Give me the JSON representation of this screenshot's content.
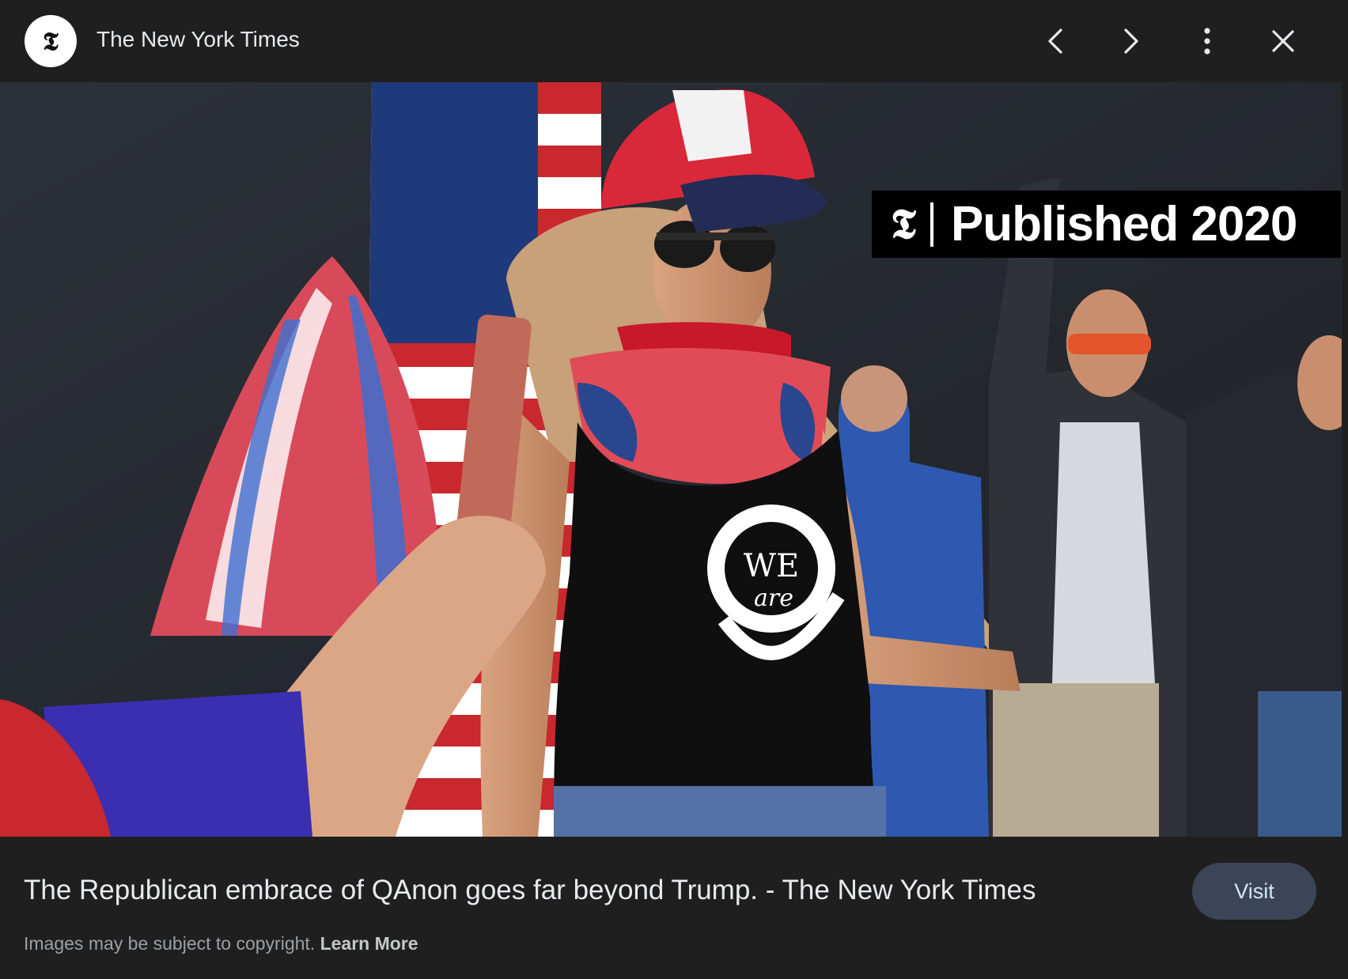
{
  "header": {
    "source_name": "The New York Times",
    "logo_glyph": "𝕿",
    "buttons": {
      "previous_icon": "chevron-left-icon",
      "next_icon": "chevron-right-icon",
      "more_icon": "more-vert-icon",
      "close_icon": "close-icon"
    }
  },
  "image": {
    "badge": {
      "logo_glyph": "𝕿",
      "text": "Published 2020"
    },
    "shirt_text_top": "WE",
    "shirt_text_bottom": "are",
    "lens_icon": "lens-search-icon"
  },
  "footer": {
    "title": "The Republican embrace of QAnon goes far beyond Trump. - The New York Times",
    "visit_label": "Visit",
    "copyright_text": "Images may be subject to copyright.",
    "learn_more_label": "Learn More"
  },
  "colors": {
    "background": "#1f1f1f",
    "visit_button": "#3c4557",
    "visit_text": "#d3e3fd",
    "secondary_text": "#9aa0a6"
  }
}
